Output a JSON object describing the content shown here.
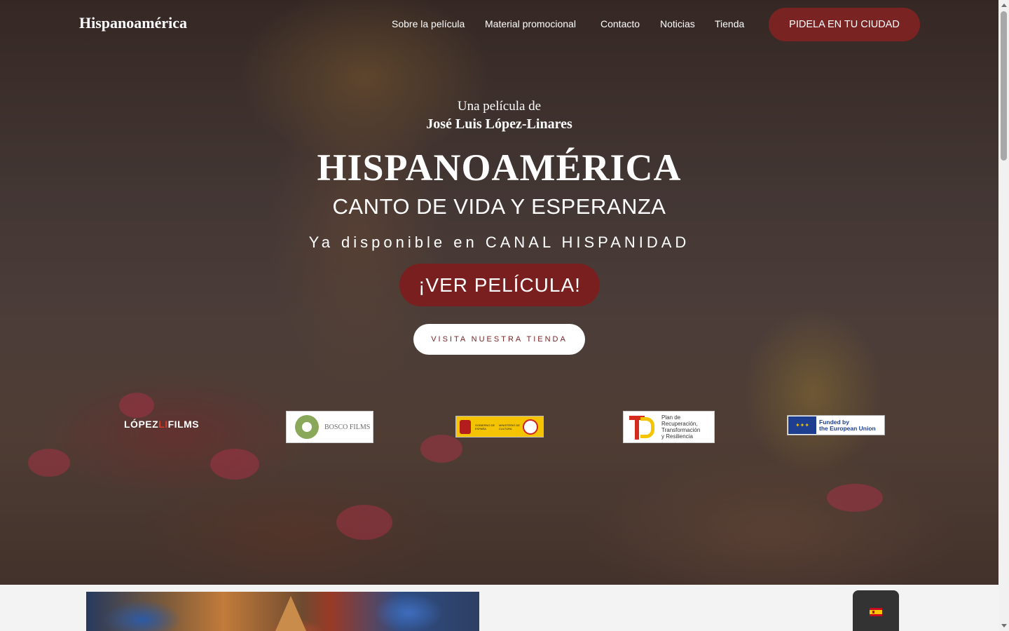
{
  "nav": {
    "brand": "Hispanoamérica",
    "links": [
      "Sobre la película",
      "Material promocional",
      "Contacto",
      "Noticias",
      "Tienda"
    ],
    "cta": "PIDELA EN TU CIUDAD"
  },
  "hero": {
    "byline_1": "Una película de",
    "byline_2": "José Luis López-Linares",
    "title": "HISPANOAMÉRICA",
    "subtitle": "CANTO DE VIDA Y ESPERANZA",
    "availability": "Ya disponible en CANAL HISPANIDAD",
    "watch_button": "¡VER PELÍCULA!",
    "shop_button": "VISITA NUESTRA TIENDA"
  },
  "sponsors": {
    "lopez_a": "LÓPEZ",
    "lopez_b": "LI",
    "lopez_c": "FILMS",
    "bosco": "BOSCO FILMS",
    "gob_1": "GOBIERNO DE ESPAÑA",
    "gob_2": "MINISTERIO DE CULTURA",
    "gob_icon": "ICAA",
    "prtr_1": "Plan de",
    "prtr_2": "Recuperación,",
    "prtr_3": "Transformación",
    "prtr_4": "y Resiliencia",
    "eu_1": "Funded by",
    "eu_2": "the European Union"
  },
  "language": {
    "current": "es",
    "flag_icon": "spain-flag-icon"
  },
  "colors": {
    "accent": "#7a2323",
    "white": "#ffffff"
  }
}
